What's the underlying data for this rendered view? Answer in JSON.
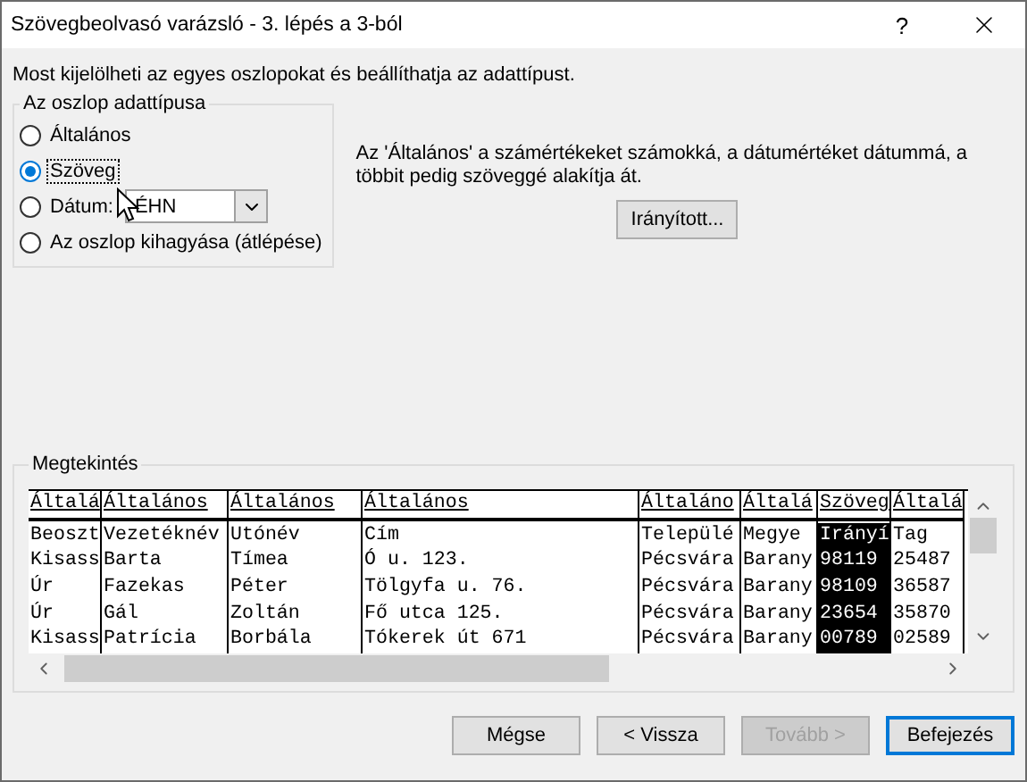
{
  "window": {
    "title": "Szövegbeolvasó varázsló - 3. lépés a 3-ból",
    "help_label": "?"
  },
  "instruction": "Most kijelölheti az egyes oszlopokat és beállíthatja az adattípust.",
  "column_type": {
    "legend": "Az oszlop adattípusa",
    "options": [
      {
        "kind": "plain",
        "label": "Általános",
        "selected": false,
        "focused": false
      },
      {
        "kind": "plain",
        "label": "Szöveg",
        "selected": true,
        "focused": true
      },
      {
        "kind": "date",
        "label": "Dátum:",
        "selected": false,
        "focused": false,
        "date_format": "ÉHN"
      },
      {
        "kind": "plain",
        "label": "Az oszlop kihagyása (átlépése)",
        "selected": false,
        "focused": false
      }
    ]
  },
  "description": "Az 'Általános' a számértékeket számokká, a dátumértéket dátummá, a többit pedig szöveggé alakítja át.",
  "advanced_button": "Irányított...",
  "preview": {
    "legend": "Megtekintés",
    "columns": [
      {
        "header": "Általá",
        "selected": false,
        "cells": [
          "Beoszt",
          "Kisass",
          "Úr",
          "Úr",
          "Kisass"
        ]
      },
      {
        "header": "Általános",
        "selected": false,
        "cells": [
          "Vezetéknév",
          "Barta",
          "Fazekas",
          "Gál",
          "Patrícia"
        ]
      },
      {
        "header": "Általános",
        "selected": false,
        "cells": [
          "Utónév",
          "Tímea",
          "Péter",
          "Zoltán",
          "Borbála"
        ]
      },
      {
        "header": "Általános",
        "selected": false,
        "cells": [
          "Cím",
          "Ó u. 123.",
          "Tölgyfa u. 76.",
          "Fő utca 125.",
          "Tókerek út 671"
        ]
      },
      {
        "header": "Általáno",
        "selected": false,
        "cells": [
          "Települé",
          "Pécsvára",
          "Pécsvára",
          "Pécsvára",
          "Pécsvára"
        ]
      },
      {
        "header": "Általá",
        "selected": false,
        "cells": [
          "Megye",
          "Barany",
          "Barany",
          "Barany",
          "Barany"
        ]
      },
      {
        "header": "Szöveg",
        "selected": true,
        "cells": [
          "Irányí",
          "98119",
          "98109",
          "23654",
          "00789"
        ]
      },
      {
        "header": "Általá",
        "selected": false,
        "cells": [
          "Tag",
          "25487",
          "36587",
          "35870",
          "02589"
        ]
      }
    ]
  },
  "buttons": [
    {
      "label": "Mégse",
      "disabled": false,
      "default": false
    },
    {
      "label": "< Vissza",
      "disabled": false,
      "default": false
    },
    {
      "label": "Tovább >",
      "disabled": true,
      "default": false
    },
    {
      "label": "Befejezés",
      "disabled": false,
      "default": true
    }
  ]
}
